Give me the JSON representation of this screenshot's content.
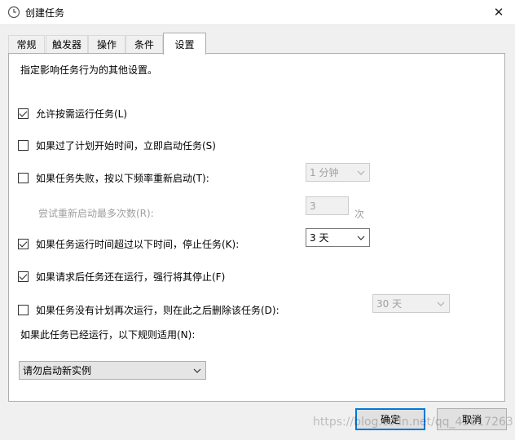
{
  "window": {
    "title": "创建任务",
    "close_glyph": "✕"
  },
  "tabs": [
    "常规",
    "触发器",
    "操作",
    "条件",
    "设置"
  ],
  "panel": {
    "description": "指定影响任务行为的其他设置。",
    "opt_allow_demand": "允许按需运行任务(L)",
    "opt_missed_start": "如果过了计划开始时间，立即启动任务(S)",
    "opt_restart_fail": "如果任务失败，按以下频率重新启动(T):",
    "restart_interval_value": "1 分钟",
    "restart_attempts_label": "尝试重新启动最多次数(R):",
    "restart_attempts_value": "3",
    "restart_attempts_unit": "次",
    "opt_stop_long": "如果任务运行时间超过以下时间，停止任务(K):",
    "stop_after_value": "3 天",
    "opt_force_stop": "如果请求后任务还在运行，强行将其停止(F)",
    "opt_delete_unscheduled": "如果任务没有计划再次运行，则在此之后删除该任务(D):",
    "delete_after_value": "30 天",
    "rule_label": "如果此任务已经运行，以下规则适用(N):",
    "rule_value": "请勿启动新实例"
  },
  "buttons": {
    "ok": "确定",
    "cancel": "取消"
  },
  "watermark": "https://blog.csdn.net/qq_43817263"
}
